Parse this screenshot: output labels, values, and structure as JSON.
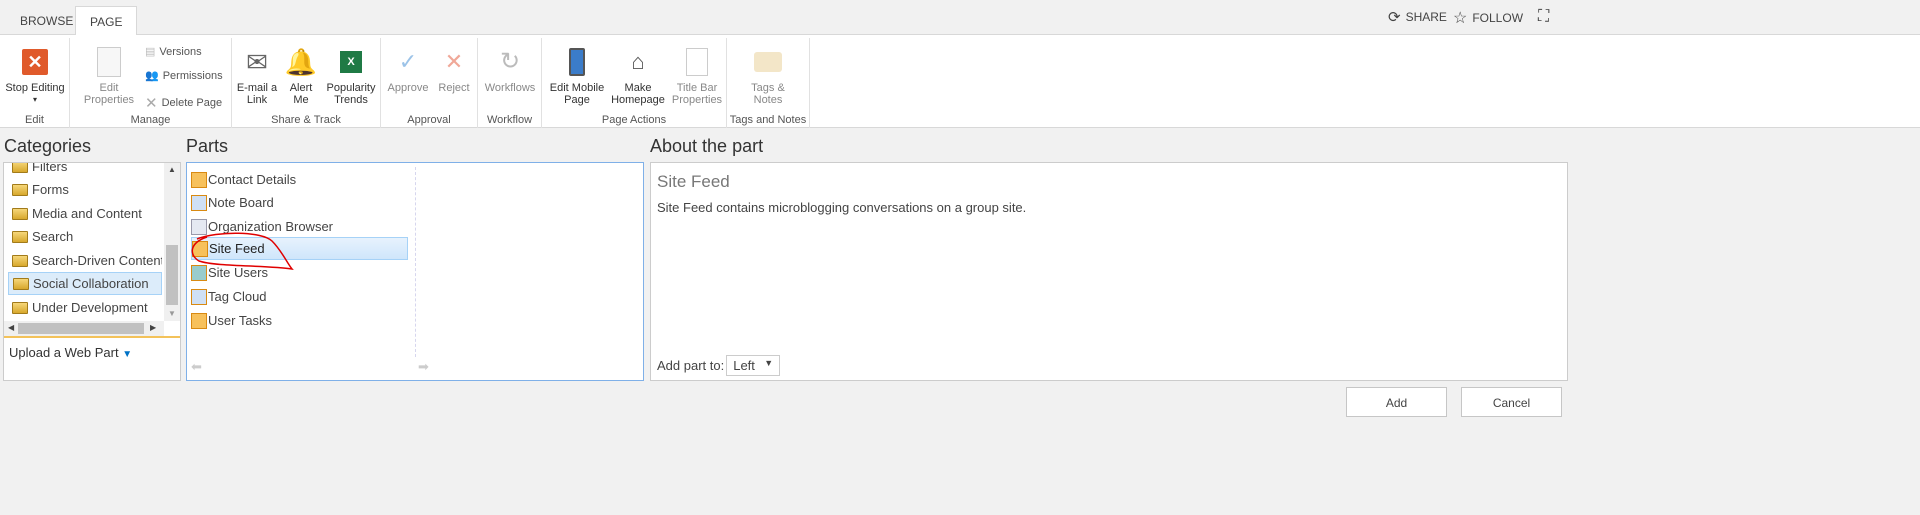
{
  "tabs": {
    "browse": "BROWSE",
    "page": "PAGE"
  },
  "top_actions": {
    "share": "SHARE",
    "follow": "FOLLOW"
  },
  "ribbon": {
    "edit": {
      "label": "Edit",
      "stop_editing": "Stop Editing"
    },
    "manage": {
      "label": "Manage",
      "edit_properties_1": "Edit",
      "edit_properties_2": "Properties",
      "versions": "Versions",
      "permissions": "Permissions",
      "delete_page": "Delete Page"
    },
    "share": {
      "label": "Share & Track",
      "email_1": "E-mail a",
      "email_2": "Link",
      "alert_1": "Alert",
      "alert_2": "Me",
      "pop_1": "Popularity",
      "pop_2": "Trends"
    },
    "approval": {
      "label": "Approval",
      "approve": "Approve",
      "reject": "Reject"
    },
    "workflow": {
      "label": "Workflow",
      "workflows": "Workflows"
    },
    "page_actions": {
      "label": "Page Actions",
      "mobile_1": "Edit Mobile",
      "mobile_2": "Page",
      "home_1": "Make",
      "home_2": "Homepage",
      "title_1": "Title Bar",
      "title_2": "Properties"
    },
    "tags": {
      "label": "Tags and Notes",
      "tags_1": "Tags &",
      "tags_2": "Notes"
    }
  },
  "categories": {
    "title": "Categories",
    "items": [
      "Filters",
      "Forms",
      "Media and Content",
      "Search",
      "Search-Driven Content",
      "Social Collaboration",
      "Under Development"
    ],
    "selected": "Social Collaboration",
    "upload": "Upload a Web Part"
  },
  "parts": {
    "title": "Parts",
    "items": [
      "Contact Details",
      "Note Board",
      "Organization Browser",
      "Site Feed",
      "Site Users",
      "Tag Cloud",
      "User Tasks"
    ],
    "selected": "Site Feed"
  },
  "about": {
    "title": "About the part",
    "part_name": "Site Feed",
    "description": "Site Feed contains microblogging conversations on a group site.",
    "add_to_label": "Add part to:",
    "add_to_value": "Left"
  },
  "buttons": {
    "add": "Add",
    "cancel": "Cancel"
  },
  "colors": {
    "accent": "#0072c6",
    "annotation": "#e00000"
  }
}
